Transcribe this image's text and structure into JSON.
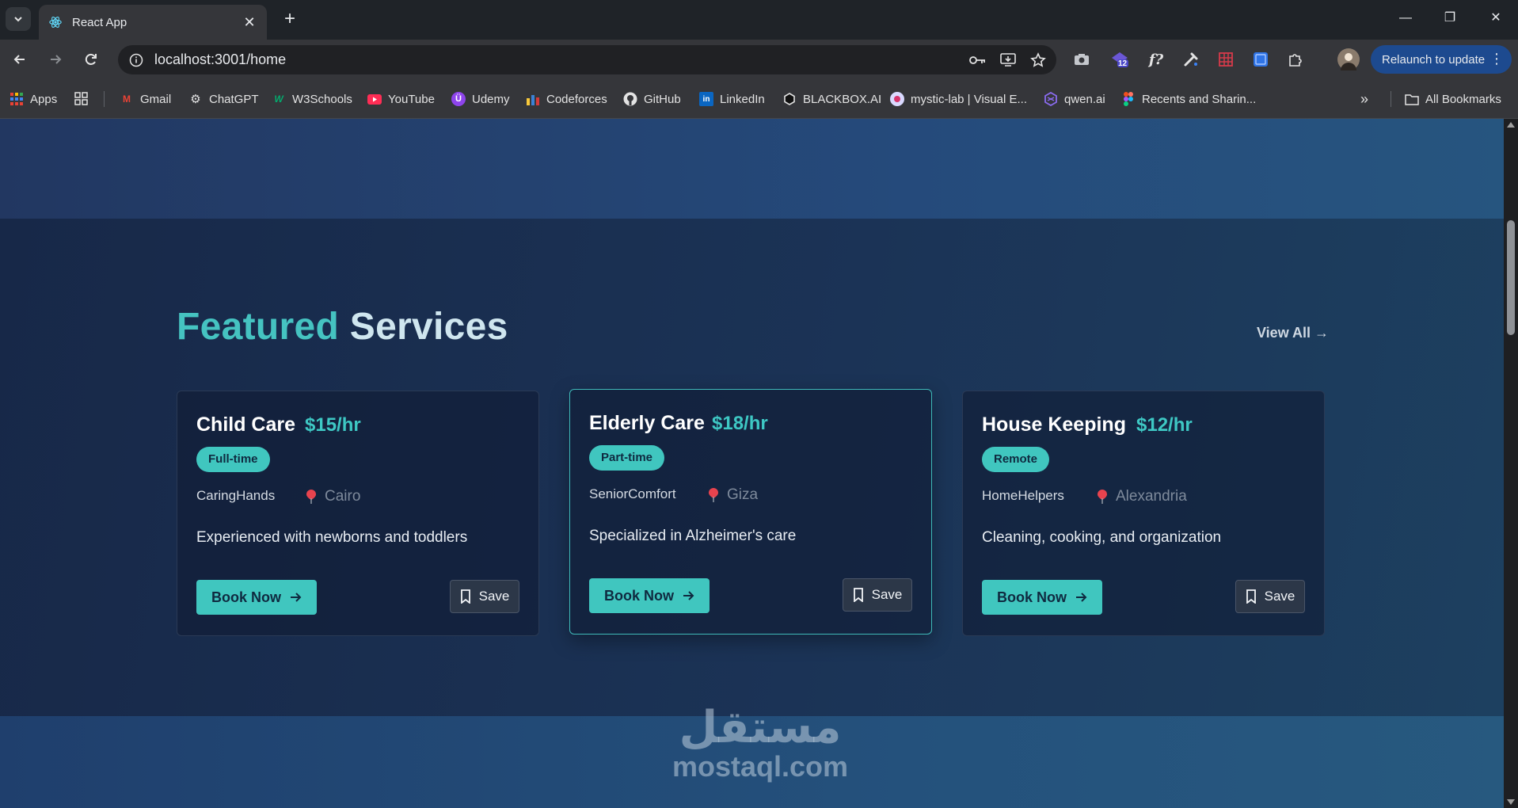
{
  "browser": {
    "tab_title": "React App",
    "url": "localhost:3001/home",
    "relaunch_label": "Relaunch to update",
    "extension_badge": "12",
    "bookmarks": [
      "Apps",
      "Gmail",
      "ChatGPT",
      "W3Schools",
      "YouTube",
      "Udemy",
      "Codeforces",
      "GitHub",
      "LinkedIn",
      "BLACKBOX.AI",
      "mystic-lab | Visual E...",
      "qwen.ai",
      "Recents and Sharin..."
    ],
    "all_bookmarks_label": "All Bookmarks",
    "colors": {
      "tab_strip": "#1f2328",
      "toolbar": "#35363a",
      "relaunch": "#1d4a8f"
    }
  },
  "featured": {
    "title_part1": "Featured",
    "title_part2": "Services",
    "view_all_label": "View All →",
    "cards": [
      {
        "name": "Child Care",
        "rate": "$15/hr",
        "type": "Full-time",
        "company": "CaringHands",
        "location": "Cairo",
        "description": "Experienced with newborns and toddlers",
        "book_label": "Book Now",
        "save_label": "Save"
      },
      {
        "name": "Elderly Care",
        "rate": "$18/hr",
        "type": "Part-time",
        "company": "SeniorComfort",
        "location": "Giza",
        "description": "Specialized in Alzheimer's care",
        "book_label": "Book Now",
        "save_label": "Save"
      },
      {
        "name": "House Keeping",
        "rate": "$12/hr",
        "type": "Remote",
        "company": "HomeHelpers",
        "location": "Alexandria",
        "description": "Cleaning, cooking, and organization",
        "book_label": "Book Now",
        "save_label": "Save"
      }
    ]
  },
  "watermark": {
    "arabic": "مستقل",
    "latin": "mostaql.com"
  },
  "theme": {
    "accent": "#40c6bf",
    "heading_light": "#cfe6ef",
    "page_bg": "#172848"
  }
}
